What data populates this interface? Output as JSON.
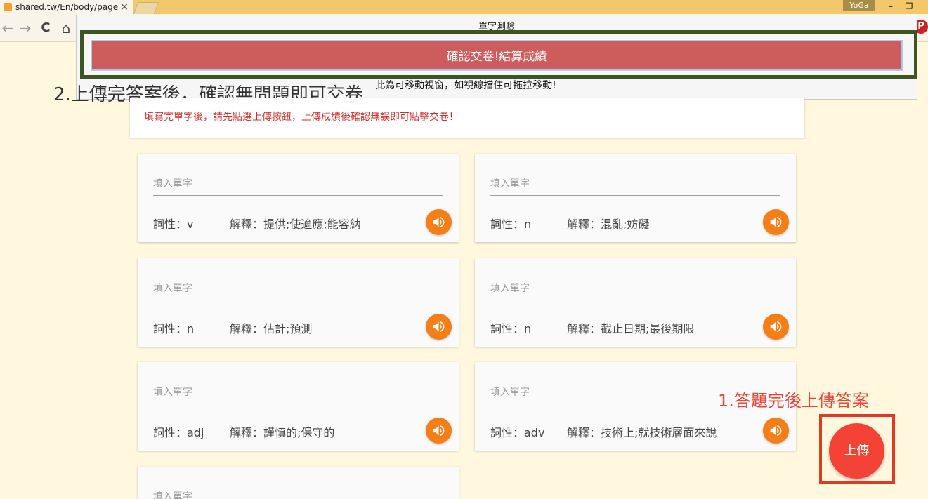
{
  "browser": {
    "tab_title": "shared.tw/En/body/page",
    "tab_close": "×",
    "profile_name": "YoGa",
    "minimize": "–",
    "restore": "❐",
    "back": "←",
    "forward": "→",
    "reload": "C",
    "home": "⌂",
    "pinterest": "P"
  },
  "dialog": {
    "title": "單字測驗",
    "submit_label": "確認交卷!結算成績",
    "hint": "此為可移動視窗，如視線擋住可拖拉移動!"
  },
  "annotations": {
    "step2": "2.上傳完答案後，確認無問題即可交卷",
    "step1": "1.答題完後上傳答案"
  },
  "notice": "填寫完單字後，請先點選上傳按鈕，上傳成績後確認無誤即可點擊交卷！",
  "cards": [
    {
      "placeholder": "填入單字",
      "pos": "詞性：v",
      "def": "解釋：提供;使適應;能容納"
    },
    {
      "placeholder": "填入單字",
      "pos": "詞性：n",
      "def": "解釋：混亂;妨礙"
    },
    {
      "placeholder": "填入單字",
      "pos": "詞性：n",
      "def": "解釋：估計;預測"
    },
    {
      "placeholder": "填入單字",
      "pos": "詞性：n",
      "def": "解釋：截止日期;最後期限"
    },
    {
      "placeholder": "填入單字",
      "pos": "詞性：adj",
      "def": "解釋：謹慎的;保守的"
    },
    {
      "placeholder": "填入單字",
      "pos": "詞性：adv",
      "def": "解釋：技術上;就技術層面來說"
    },
    {
      "placeholder": "填入單字",
      "pos": "",
      "def": ""
    }
  ],
  "upload_label": "上傳",
  "icons": {
    "speak": "volume-up-icon"
  },
  "colors": {
    "submit_button": "#cd5c5c",
    "speak_button": "#f57f17",
    "upload_button": "#f44336",
    "notice_text": "#d32f2f",
    "highlight_green": "#3d5522",
    "highlight_red": "#e23a21"
  }
}
